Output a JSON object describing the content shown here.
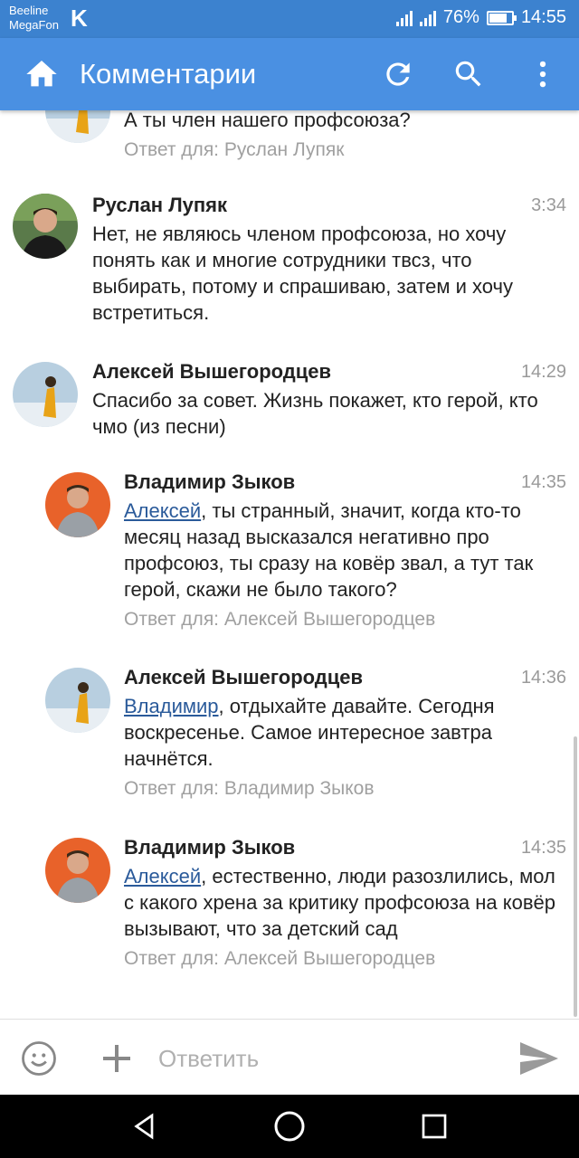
{
  "status_bar": {
    "carrier1": "Beeline",
    "carrier2": "MegaFon",
    "app_badge": "K",
    "battery": "76%",
    "battery_level": 0.76,
    "time": "14:55"
  },
  "app_bar": {
    "title": "Комментарии",
    "home_icon": "home-icon",
    "refresh_icon": "refresh-icon",
    "search_icon": "search-icon",
    "more_icon": "more-vert-icon",
    "color": "#4a90e2"
  },
  "comments": [
    {
      "author": "",
      "time": "",
      "text": "А ты член нашего профсоюза?",
      "reply_to": "Ответ для: Руслан Лупяк"
    },
    {
      "author": "Руслан Лупяк",
      "time": "3:34",
      "text": "Нет, не являюсь членом профсоюза, но хочу понять как и многие сотрудники твсз, что выбирать, потому и спрашиваю, затем и хочу встретиться."
    },
    {
      "author": "Алексей Вышегородцев",
      "time": "14:29",
      "text": "Спасибо за совет. Жизнь покажет, кто герой, кто чмо (из песни)"
    },
    {
      "author": "Владимир Зыков",
      "time": "14:35",
      "mention": "Алексей",
      "text": ", ты странный, значит, когда кто-то месяц назад высказался негативно про профсоюз, ты сразу на ковёр звал, а тут так герой, скажи не было такого?",
      "reply_to": "Ответ для: Алексей Вышегородцев"
    },
    {
      "author": "Алексей Вышегородцев",
      "time": "14:36",
      "mention": "Владимир",
      "text": ", отдыхайте давайте. Сегодня воскресенье. Самое интересное завтра начнётся.",
      "reply_to": "Ответ для: Владимир Зыков"
    },
    {
      "author": "Владимир Зыков",
      "time": "14:35",
      "mention": "Алексей",
      "text": ", естественно, люди разозлились, мол с какого хрена за критику профсоюза на ковёр вызывают, что за детский сад",
      "reply_to": "Ответ для: Алексей Вышегородцев"
    }
  ],
  "input_bar": {
    "placeholder": "Ответить",
    "emoji_icon": "emoji-icon",
    "add_icon": "plus-icon",
    "send_icon": "send-icon"
  },
  "nav_bar": {
    "back_icon": "back-triangle-icon",
    "home_icon": "home-circle-icon",
    "recents_icon": "recents-square-icon"
  }
}
